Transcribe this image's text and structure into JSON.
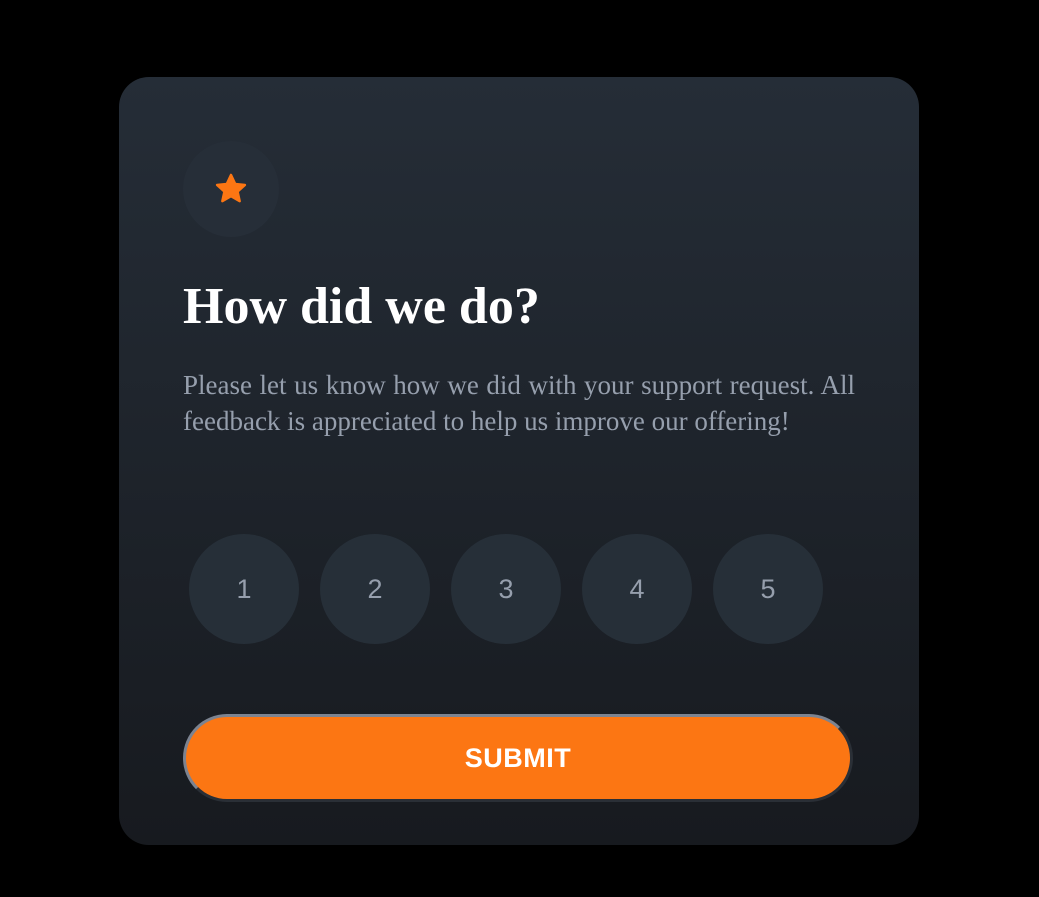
{
  "icon": {
    "name": "star-icon",
    "color": "#fc7613",
    "background": "#262e38"
  },
  "title": "How did we do?",
  "description": "Please let us know how we did with your support request. All feedback is appreciated to help us improve our offering!",
  "ratings": [
    "1",
    "2",
    "3",
    "4",
    "5"
  ],
  "submit_label": "SUBMIT",
  "colors": {
    "page_background": "#000000",
    "card_gradient_top": "#252d37",
    "card_gradient_bottom": "#171a1f",
    "accent": "#fc7613",
    "muted_text": "#969fad",
    "rating_background": "#262f38",
    "title_text": "#ffffff"
  }
}
